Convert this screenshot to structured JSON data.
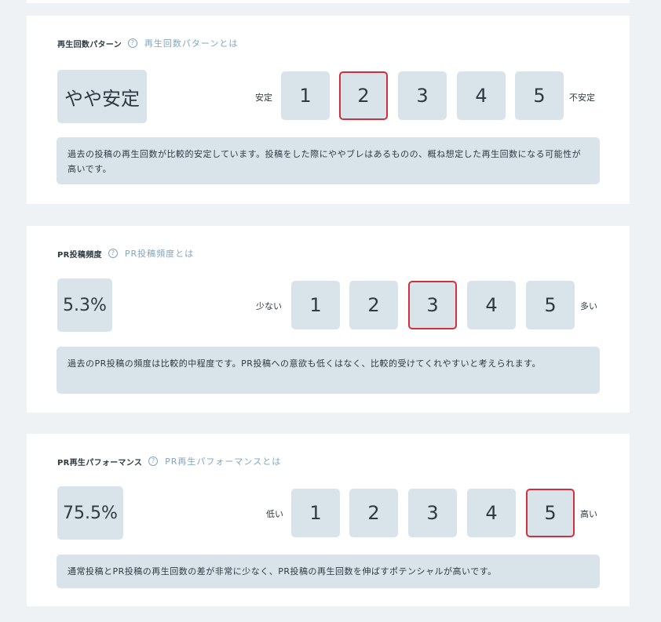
{
  "sections": [
    {
      "title": "再生回数パターン",
      "help_icon": "question-circle-icon",
      "help_link": "再生回数パターンとは",
      "value": "やや安定",
      "scale_low": "安定",
      "scale_high": "不安定",
      "scale": [
        "1",
        "2",
        "3",
        "4",
        "5"
      ],
      "selected": 2,
      "description": "過去の投稿の再生回数が比較的安定しています。投稿をした際にややブレはあるものの、概ね想定した再生回数になる可能性が高いです。"
    },
    {
      "title": "PR投稿頻度",
      "help_icon": "question-circle-icon",
      "help_link": "PR投稿頻度とは",
      "value": "5.3%",
      "scale_low": "少ない",
      "scale_high": "多い",
      "scale": [
        "1",
        "2",
        "3",
        "4",
        "5"
      ],
      "selected": 3,
      "description": "過去のPR投稿の頻度は比較的中程度です。PR投稿への意欲も低くはなく、比較的受けてくれやすいと考えられます。"
    },
    {
      "title": "PR再生パフォーマンス",
      "help_icon": "question-circle-icon",
      "help_link": "PR再生パフォーマンスとは",
      "value": "75.5%",
      "scale_low": "低い",
      "scale_high": "高い",
      "scale": [
        "1",
        "2",
        "3",
        "4",
        "5"
      ],
      "selected": 5,
      "description": "通常投稿とPR投稿の再生回数の差が非常に少なく、PR投稿の再生回数を伸ばすポテンシャルが高いです。"
    }
  ],
  "colors": {
    "page_background": "#eef2f4",
    "card_background": "#ffffff",
    "box_fill": "#d8e4e9",
    "selected_border": "#d0303d",
    "link_color": "#7fa6c0",
    "text": "#2e3a42"
  }
}
